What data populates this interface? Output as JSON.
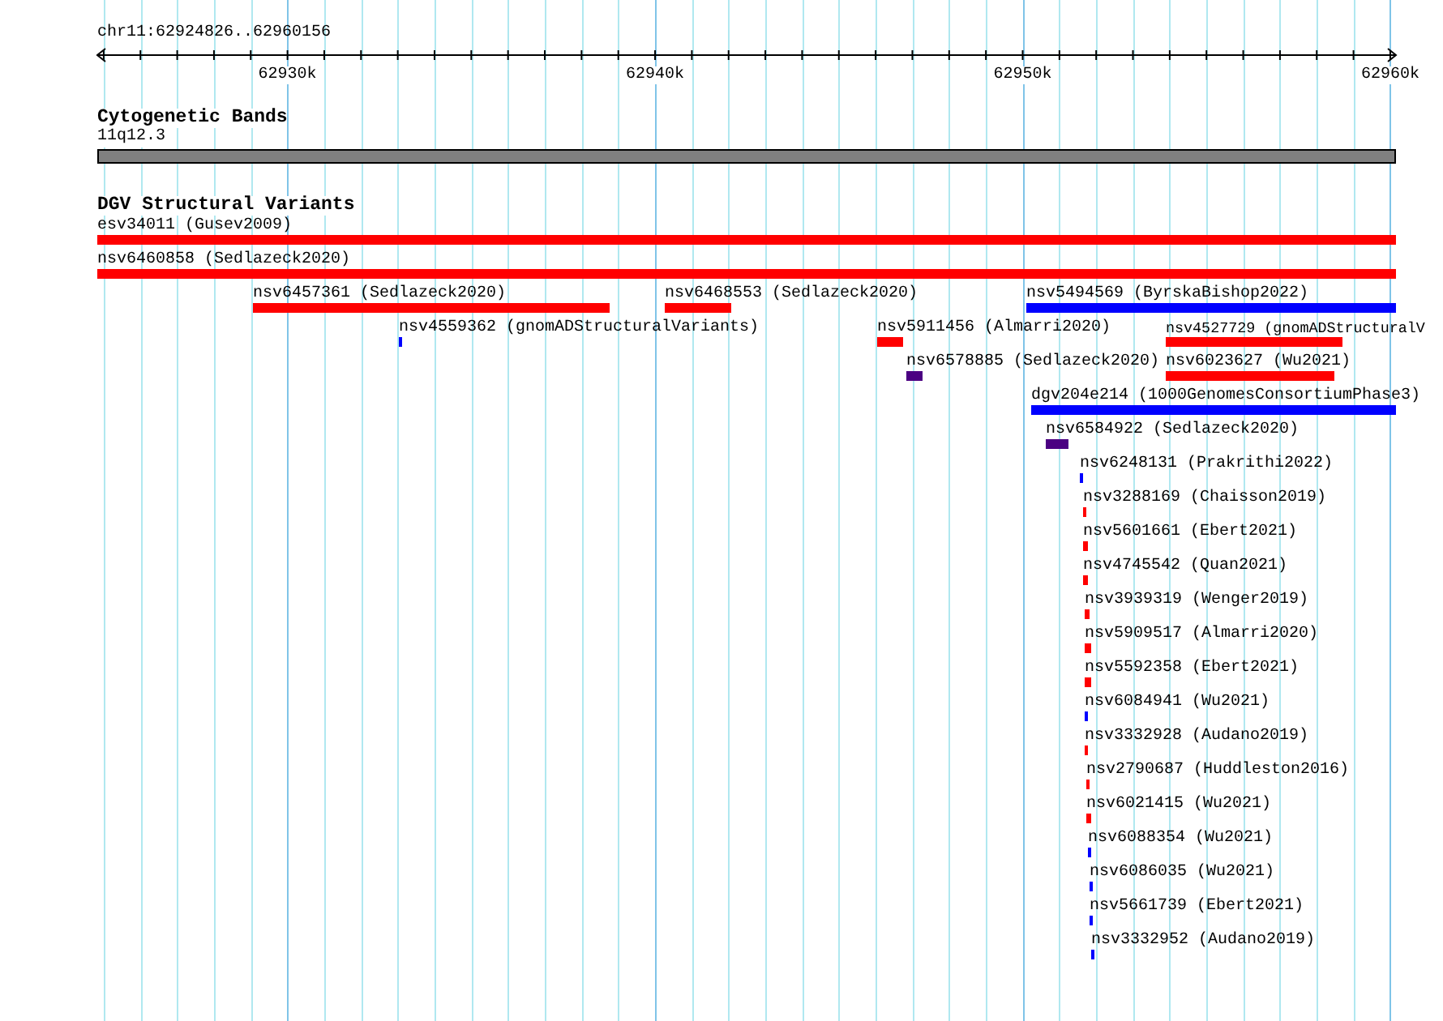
{
  "ruler": {
    "location": "chr11:62924826..62960156",
    "ticks": [
      "62930k",
      "62940k",
      "62950k",
      "62960k"
    ]
  },
  "tracks": [
    {
      "kind": "bands",
      "title": "Cytogenetic Bands",
      "band": "11q12.3"
    },
    {
      "kind": "features",
      "title": "DGV Structural Variants",
      "features": [
        {
          "label": "esv34011 (Gusev2009)",
          "color": "#ff0000"
        },
        {
          "label": "nsv6460858 (Sedlazeck2020)",
          "color": "#ff0000"
        },
        {
          "label": "nsv6457361 (Sedlazeck2020)",
          "color": "#ff0000"
        },
        {
          "label": "nsv6468553 (Sedlazeck2020)",
          "color": "#ff0000"
        },
        {
          "label": "nsv5494569 (ByrskaBishop2022)",
          "color": "#0000ff"
        },
        {
          "label": "nsv4559362 (gnomADStructuralVariants)",
          "color": "#0000ff"
        },
        {
          "label": "nsv5911456 (Almarri2020)",
          "color": "#ff0000"
        },
        {
          "label": "nsv4527729 (gnomADStructuralV",
          "color": "#ff0000"
        },
        {
          "label": "nsv6578885 (Sedlazeck2020)",
          "color": "#4b0082"
        },
        {
          "label": "nsv6023627 (Wu2021)",
          "color": "#ff0000"
        },
        {
          "label": "dgv204e214 (1000GenomesConsortiumPhase3)",
          "color": "#0000ff"
        },
        {
          "label": "nsv6584922 (Sedlazeck2020)",
          "color": "#4b0082"
        },
        {
          "label": "nsv6248131 (Prakrithi2022)",
          "color": "#0000ff"
        },
        {
          "label": "nsv3288169 (Chaisson2019)",
          "color": "#ff0000"
        },
        {
          "label": "nsv5601661 (Ebert2021)",
          "color": "#ff0000"
        },
        {
          "label": "nsv4745542 (Quan2021)",
          "color": "#ff0000"
        },
        {
          "label": "nsv3939319 (Wenger2019)",
          "color": "#ff0000"
        },
        {
          "label": "nsv5909517 (Almarri2020)",
          "color": "#ff0000"
        },
        {
          "label": "nsv5592358 (Ebert2021)",
          "color": "#ff0000"
        },
        {
          "label": "nsv6084941 (Wu2021)",
          "color": "#0000ff"
        },
        {
          "label": "nsv3332928 (Audano2019)",
          "color": "#ff0000"
        },
        {
          "label": "nsv2790687 (Huddleston2016)",
          "color": "#ff0000"
        },
        {
          "label": "nsv6021415 (Wu2021)",
          "color": "#ff0000"
        },
        {
          "label": "nsv6088354 (Wu2021)",
          "color": "#0000ff"
        },
        {
          "label": "nsv6086035 (Wu2021)",
          "color": "#0000ff"
        },
        {
          "label": "nsv5661739 (Ebert2021)",
          "color": "#0000ff"
        },
        {
          "label": "nsv3332952 (Audano2019)",
          "color": "#0000ff"
        }
      ]
    }
  ]
}
